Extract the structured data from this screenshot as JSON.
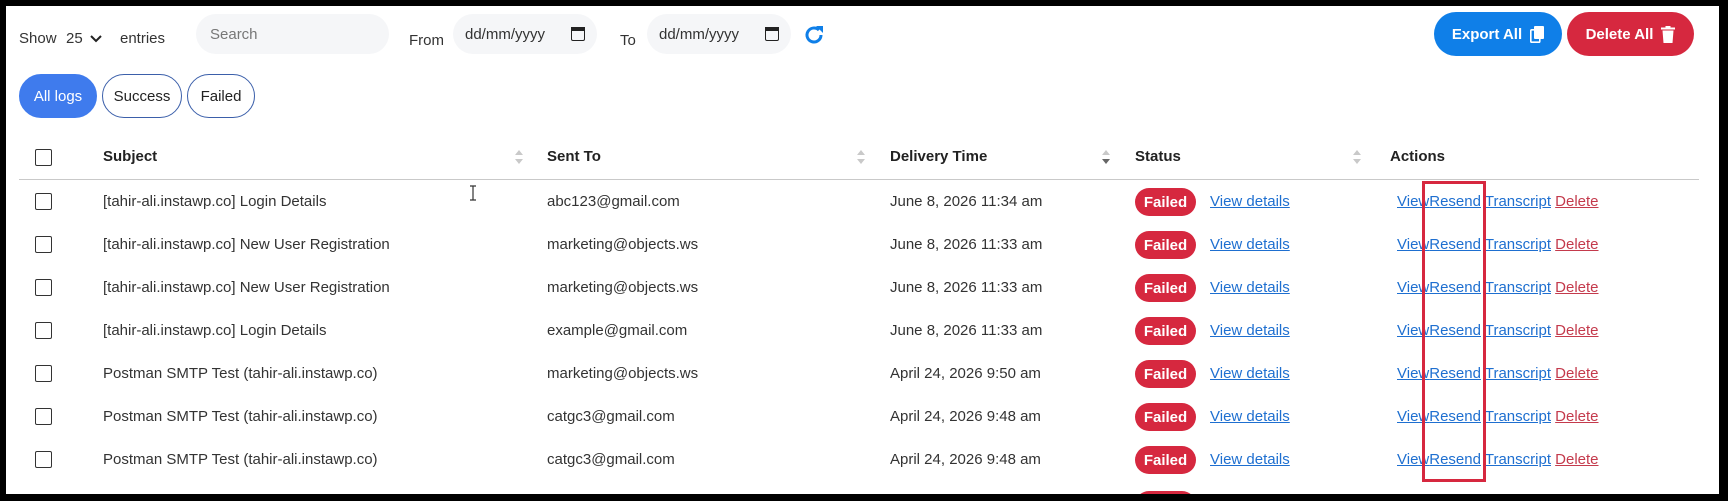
{
  "toolbar": {
    "show_label": "Show",
    "show_value": "25",
    "entries_label": "entries",
    "search_placeholder": "Search",
    "from_label": "From",
    "from_placeholder": "dd/mm/yyyy",
    "to_label": "To",
    "to_placeholder": "dd/mm/yyyy",
    "export_label": "Export All",
    "delete_label": "Delete All"
  },
  "tabs": [
    {
      "label": "All logs",
      "active": true
    },
    {
      "label": "Success",
      "active": false
    },
    {
      "label": "Failed",
      "active": false
    }
  ],
  "columns": {
    "subject": "Subject",
    "sent_to": "Sent To",
    "delivery_time": "Delivery Time",
    "status": "Status",
    "actions": "Actions"
  },
  "rows": [
    {
      "subject": "[tahir-ali.instawp.co] Login Details",
      "sent_to": "abc123@gmail.com",
      "time": "June 8, 2026 11:34 am",
      "status": "Failed",
      "details": "View details"
    },
    {
      "subject": "[tahir-ali.instawp.co] New User Registration",
      "sent_to": "marketing@objects.ws",
      "time": "June 8, 2026 11:33 am",
      "status": "Failed",
      "details": "View details"
    },
    {
      "subject": "[tahir-ali.instawp.co] New User Registration",
      "sent_to": "marketing@objects.ws",
      "time": "June 8, 2026 11:33 am",
      "status": "Failed",
      "details": "View details"
    },
    {
      "subject": "[tahir-ali.instawp.co] Login Details",
      "sent_to": "example@gmail.com",
      "time": "June 8, 2026 11:33 am",
      "status": "Failed",
      "details": "View details"
    },
    {
      "subject": "Postman SMTP Test (tahir-ali.instawp.co)",
      "sent_to": "marketing@objects.ws",
      "time": "April 24, 2026 9:50 am",
      "status": "Failed",
      "details": "View details"
    },
    {
      "subject": "Postman SMTP Test (tahir-ali.instawp.co)",
      "sent_to": "catgc3@gmail.com",
      "time": "April 24, 2026 9:48 am",
      "status": "Failed",
      "details": "View details"
    },
    {
      "subject": "Postman SMTP Test (tahir-ali.instawp.co)",
      "sent_to": "catgc3@gmail.com",
      "time": "April 24, 2026 9:48 am",
      "status": "Failed",
      "details": "View details"
    }
  ],
  "row_actions": {
    "view": "View",
    "resend": "Resend",
    "transcript": "Transcript",
    "delete": "Delete"
  },
  "colors": {
    "primary": "#0f7fe8",
    "danger": "#d6283f",
    "tab_active": "#3f7bed",
    "link": "#1e6fd0"
  },
  "icons": {
    "export": "copy-icon",
    "delete": "trash-icon",
    "refresh": "refresh-icon",
    "date": "calendar-icon",
    "show": "chevron-down-icon"
  }
}
